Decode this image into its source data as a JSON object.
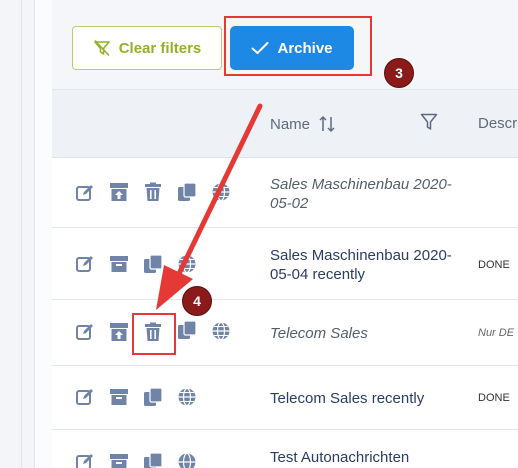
{
  "toolbar": {
    "clear_filters_label": "Clear filters",
    "archive_label": "Archive"
  },
  "annotations": {
    "step_archive": "3",
    "step_delete": "4"
  },
  "table": {
    "headers": {
      "name": "Name",
      "description": "Descr"
    },
    "rows": [
      {
        "name": "Sales Maschinenbau 2020-05-02",
        "description": "",
        "italic": true,
        "actions": [
          "edit-icon",
          "unarchive-icon",
          "trash-icon",
          "copy-icon",
          "globe-icon"
        ]
      },
      {
        "name": "Sales Maschinenbau 2020-05-04 recently",
        "description": "DONE",
        "italic": false,
        "actions": [
          "edit-icon",
          "archive-icon",
          "copy-icon",
          "globe-icon"
        ]
      },
      {
        "name": "Telecom Sales",
        "description": "Nur DE",
        "italic": true,
        "actions": [
          "edit-icon",
          "unarchive-icon",
          "trash-icon",
          "copy-icon",
          "globe-icon"
        ]
      },
      {
        "name": "Telecom Sales recently",
        "description": "DONE",
        "italic": false,
        "actions": [
          "edit-icon",
          "archive-icon",
          "copy-icon",
          "globe-icon"
        ]
      },
      {
        "name": "Test Autonachrichten",
        "description": "",
        "italic": false,
        "actions": [
          "edit-icon",
          "archive-icon",
          "copy-icon",
          "globe-icon"
        ]
      }
    ]
  },
  "colors": {
    "icon": "#6f84a6",
    "accent_blue": "#1e88e5",
    "filter_green": "#93b12a",
    "annotation_red": "#e53935",
    "badge_dark_red": "#8b1a1a"
  }
}
